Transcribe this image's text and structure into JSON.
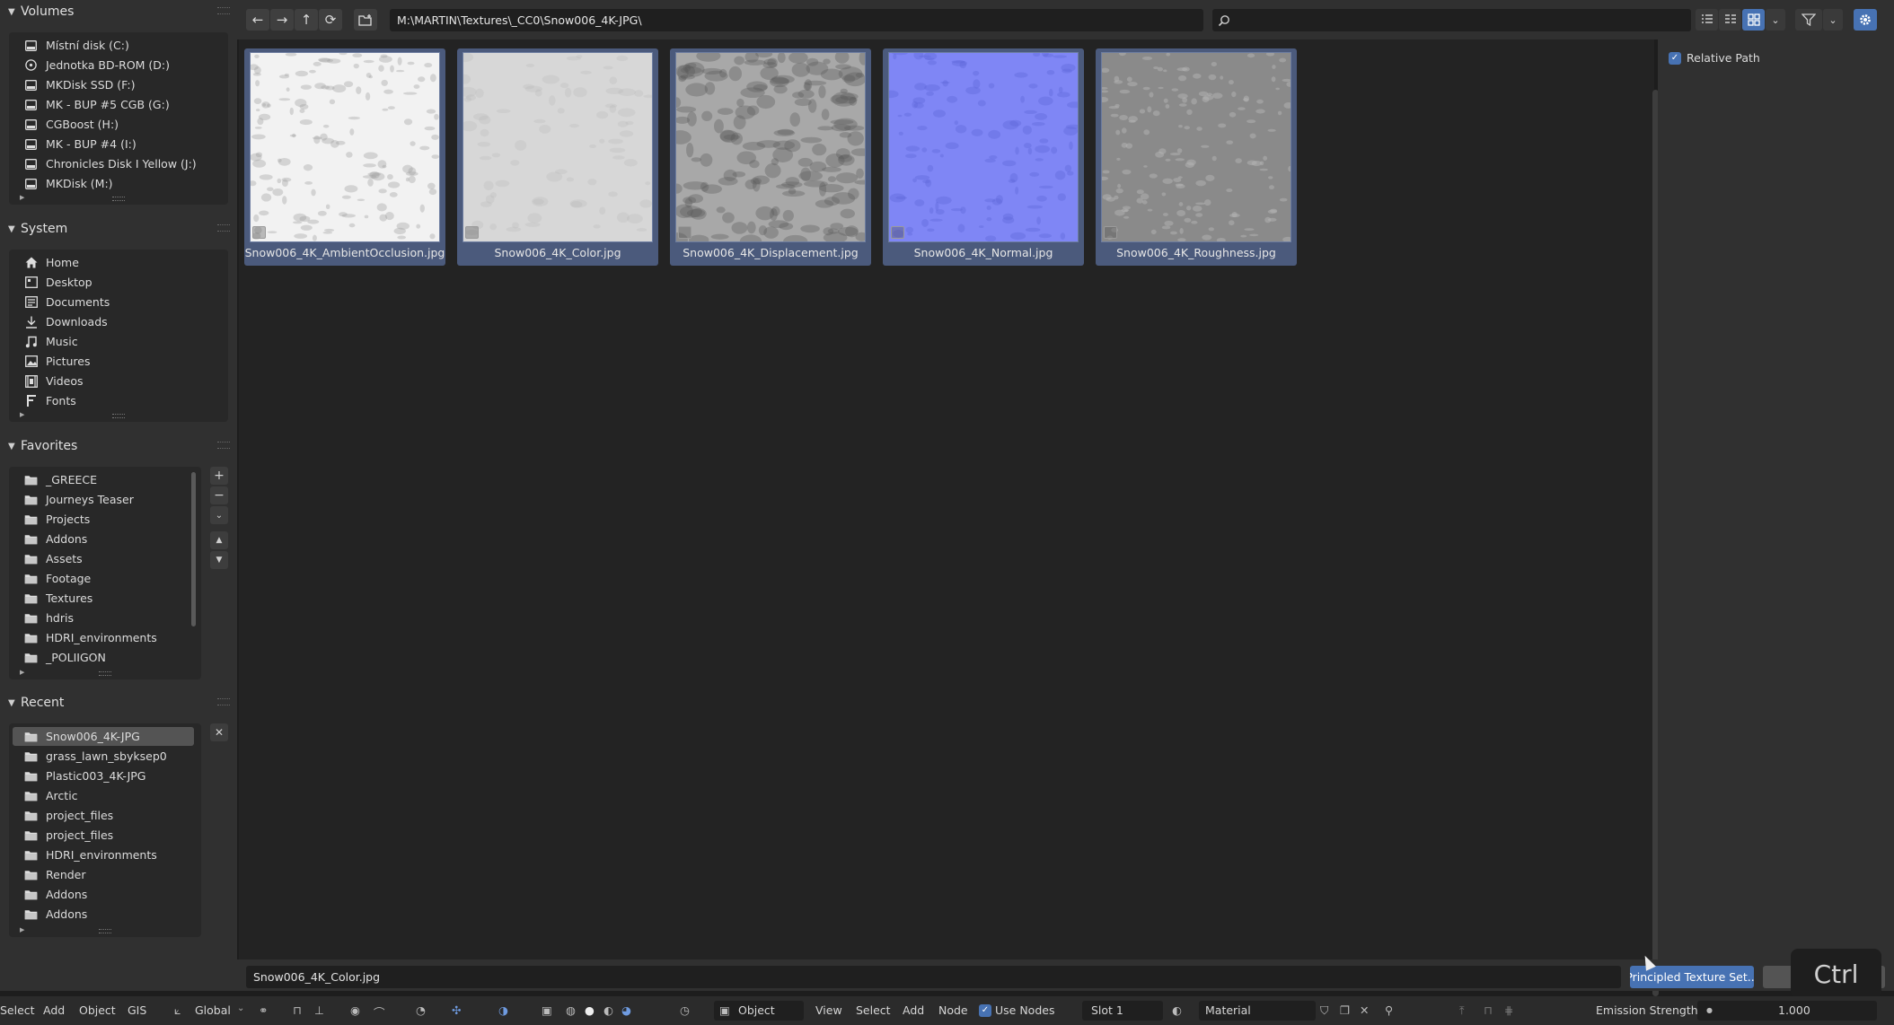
{
  "colors": {
    "accent": "#4772b3",
    "selected_tile": "#4b5a7c"
  },
  "sidebar": {
    "volumes": {
      "title": "Volumes",
      "items": [
        {
          "label": "Místní disk (C:)",
          "icon": "drive-icon"
        },
        {
          "label": "Jednotka BD-ROM (D:)",
          "icon": "disc-icon"
        },
        {
          "label": "MKDisk SSD (F:)",
          "icon": "drive-icon"
        },
        {
          "label": "MK - BUP #5 CGB (G:)",
          "icon": "drive-icon"
        },
        {
          "label": "CGBoost (H:)",
          "icon": "drive-icon"
        },
        {
          "label": "MK - BUP #4 (I:)",
          "icon": "drive-icon"
        },
        {
          "label": "Chronicles Disk I Yellow (J:)",
          "icon": "drive-icon"
        },
        {
          "label": "MKDisk (M:)",
          "icon": "drive-icon"
        }
      ]
    },
    "system": {
      "title": "System",
      "items": [
        {
          "label": "Home",
          "icon": "home-icon"
        },
        {
          "label": "Desktop",
          "icon": "desktop-icon"
        },
        {
          "label": "Documents",
          "icon": "documents-icon"
        },
        {
          "label": "Downloads",
          "icon": "downloads-icon"
        },
        {
          "label": "Music",
          "icon": "music-icon"
        },
        {
          "label": "Pictures",
          "icon": "pictures-icon"
        },
        {
          "label": "Videos",
          "icon": "videos-icon"
        },
        {
          "label": "Fonts",
          "icon": "fonts-icon"
        }
      ]
    },
    "favorites": {
      "title": "Favorites",
      "items": [
        {
          "label": "_GREECE"
        },
        {
          "label": "Journeys Teaser"
        },
        {
          "label": "Projects"
        },
        {
          "label": "Addons"
        },
        {
          "label": "Assets"
        },
        {
          "label": "Footage"
        },
        {
          "label": "Textures"
        },
        {
          "label": "hdris"
        },
        {
          "label": "HDRI_environments"
        },
        {
          "label": "_POLIIGON"
        }
      ],
      "add_glyph": "+",
      "remove_glyph": "−"
    },
    "recent": {
      "title": "Recent",
      "items": [
        {
          "label": "Snow006_4K-JPG",
          "active": true
        },
        {
          "label": "grass_lawn_sbyksep0"
        },
        {
          "label": "Plastic003_4K-JPG"
        },
        {
          "label": "Arctic"
        },
        {
          "label": "project_files"
        },
        {
          "label": "project_files"
        },
        {
          "label": "HDRI_environments"
        },
        {
          "label": "Render"
        },
        {
          "label": "Addons"
        },
        {
          "label": "Addons"
        }
      ]
    }
  },
  "toolbar": {
    "path": "M:\\MARTIN\\Textures\\_CC0\\Snow006_4K-JPG\\",
    "search_placeholder": ""
  },
  "files": [
    {
      "name": "Snow006_4K_AmbientOcclusion.jpg",
      "tex": "ao"
    },
    {
      "name": "Snow006_4K_Color.jpg",
      "tex": "color"
    },
    {
      "name": "Snow006_4K_Displacement.jpg",
      "tex": "disp"
    },
    {
      "name": "Snow006_4K_Normal.jpg",
      "tex": "normal"
    },
    {
      "name": "Snow006_4K_Roughness.jpg",
      "tex": "rough"
    }
  ],
  "options": {
    "relative_path_label": "Relative Path",
    "relative_path_checked": true
  },
  "footer": {
    "filename": "Snow006_4K_Color.jpg",
    "confirm_label": "Principled Texture Set...",
    "cancel_label": ""
  },
  "keyhint": "Ctrl",
  "statusbar": {
    "select": "Select",
    "add": "Add",
    "object": "Object",
    "gis": "GIS",
    "global": "Global",
    "object_mode": "Object",
    "view": "View",
    "select2": "Select",
    "add2": "Add",
    "node": "Node",
    "use_nodes": "Use Nodes",
    "slot": "Slot 1",
    "material": "Material",
    "emission_label": "Emission Strength",
    "emission_value": "1.000"
  }
}
